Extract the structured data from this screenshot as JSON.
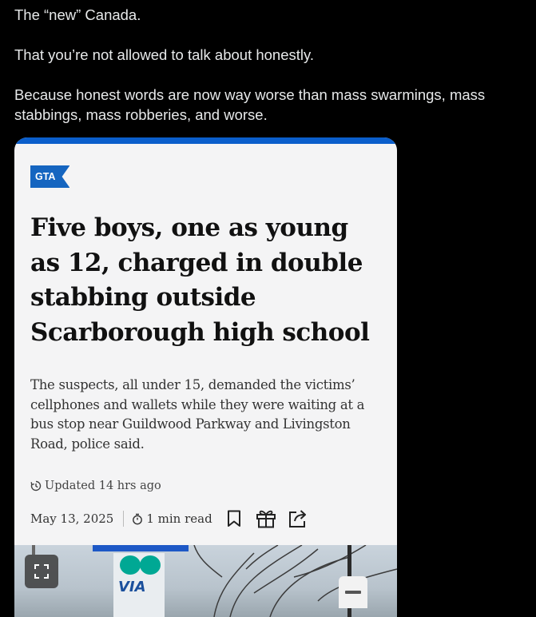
{
  "post": {
    "lines": [
      "The “new” Canada.",
      "That you’re not allowed to talk about honestly.",
      "Because honest words are now way worse than mass swarmings, mass stabbings, mass robberies, and worse."
    ]
  },
  "article": {
    "tag": "GTA",
    "headline": "Five boys, one as young as 12, charged in double stabbing outside Scarborough high school",
    "dek": "The suspects, all under 15, demanded the victims’ cellphones and wallets while they were waiting at a bus stop near Guildwood Parkway and Livingston Road, police said.",
    "updated": "Updated 14 hrs ago",
    "date": "May 13, 2025",
    "read_time": "1 min read",
    "icons": {
      "updated": "clock-refresh-icon",
      "read_time": "timer-icon",
      "bookmark": "bookmark-icon",
      "gift": "gift-icon",
      "share": "share-icon",
      "expand": "expand-icon",
      "minus": "minus-icon"
    },
    "colors": {
      "accent": "#0a5ecb",
      "tag_bg": "#1565c0",
      "card_bg": "#f4f4f5"
    }
  }
}
